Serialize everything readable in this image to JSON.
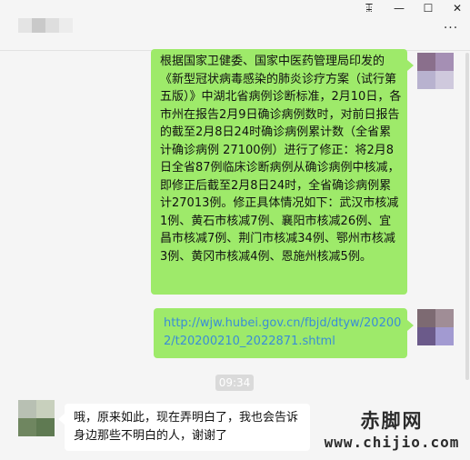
{
  "window": {
    "controls": {
      "pin": "ꔯ",
      "minimize": "—",
      "maximize": "☐",
      "close": "✕"
    },
    "more": "···"
  },
  "messages": [
    {
      "from": "me",
      "text": "根据国家卫健委、国家中医药管理局印发的《新型冠状病毒感染的肺炎诊疗方案（试行第五版）》中湖北省病例诊断标准，2月10日，各市州在报告2月9日确诊病例数时，对前日报告的截至2月8日24时确诊病例累计数（全省累计确诊病例 27100例）进行了修正：将2月8日全省87例临床诊断病例从确诊病例中核减，即修正后截至2月8日24时，全省确诊病例累计27013例。修正具体情况如下：武汉市核减1例、黄石市核减7例、襄阳市核减26例、宜昌市核减7例、荆门市核减34例、鄂州市核减3例、黄冈市核减4例、恩施州核减5例。"
    },
    {
      "from": "me",
      "link": "http://wjw.hubei.gov.cn/fbjd/dtyw/202002/t20200210_2022871.shtml"
    },
    {
      "time": "09:34"
    },
    {
      "from": "other",
      "text": "哦，原来如此，现在弄明白了，我也会告诉身边那些不明白的人，谢谢了"
    }
  ],
  "watermark": {
    "line1": "赤脚网",
    "line2": "www.chijio.com"
  },
  "colors": {
    "background": "#f5f5f5",
    "my_bubble": "#9eea6a",
    "their_bubble": "#ffffff",
    "link": "#3a8dd6"
  }
}
